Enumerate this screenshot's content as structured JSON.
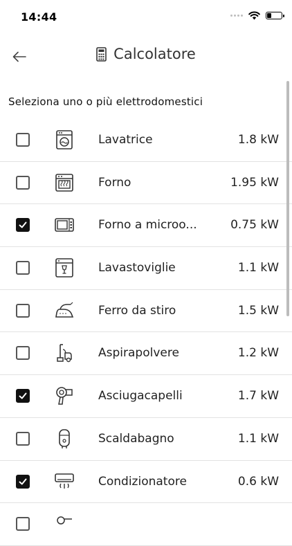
{
  "status": {
    "time": "14:44",
    "battery_level": 0.3
  },
  "header": {
    "title": "Calcolatore",
    "back_icon": "arrow-left-icon",
    "title_icon": "calculator-icon"
  },
  "subtitle": "Seleziona uno o più elettrodomestici",
  "appliances": [
    {
      "name": "Lavatrice",
      "power": "1.8 kW",
      "checked": false,
      "icon": "washing-machine-icon"
    },
    {
      "name": "Forno",
      "power": "1.95 kW",
      "checked": false,
      "icon": "oven-icon"
    },
    {
      "name": "Forno a microo...",
      "power": "0.75 kW",
      "checked": true,
      "icon": "microwave-icon"
    },
    {
      "name": "Lavastoviglie",
      "power": "1.1 kW",
      "checked": false,
      "icon": "dishwasher-icon"
    },
    {
      "name": "Ferro da stiro",
      "power": "1.5 kW",
      "checked": false,
      "icon": "iron-icon"
    },
    {
      "name": "Aspirapolvere",
      "power": "1.2 kW",
      "checked": false,
      "icon": "vacuum-cleaner-icon"
    },
    {
      "name": "Asciugacapelli",
      "power": "1.7 kW",
      "checked": true,
      "icon": "hair-dryer-icon"
    },
    {
      "name": "Scaldabagno",
      "power": "1.1 kW",
      "checked": false,
      "icon": "water-heater-icon"
    },
    {
      "name": "Condizionatore",
      "power": "0.6 kW",
      "checked": true,
      "icon": "air-conditioner-icon"
    },
    {
      "name": "",
      "power": "",
      "checked": false,
      "icon": "appliance-icon"
    }
  ]
}
